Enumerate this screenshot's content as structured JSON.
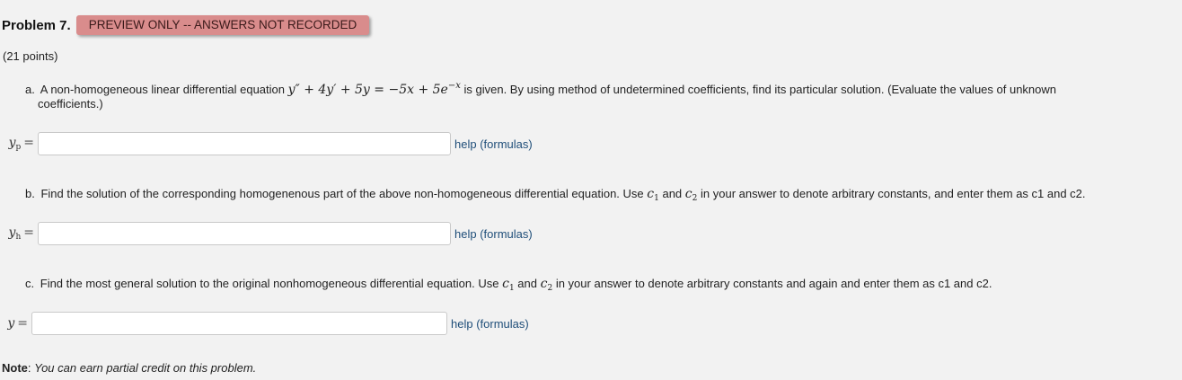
{
  "problem": {
    "title": "Problem 7.",
    "badge": "PREVIEW ONLY -- ANSWERS NOT RECORDED",
    "points": "(21 points)"
  },
  "part_a": {
    "marker": "a.",
    "text_before": "A non-homogeneous linear differential equation",
    "equation": "y″ + 4y′ + 5y = −5x + 5e",
    "equation_exp": "−x",
    "text_after": "is given. By using method of undetermined coefficients, find its particular solution. (Evaluate the values of unknown",
    "text_line2": "coefficients.)",
    "answer_label": "y",
    "answer_sub": "p",
    "answer_value": "",
    "help_label": "help (formulas)"
  },
  "part_b": {
    "marker": "b.",
    "text_before": "Find the solution of the corresponding homogenenous part of the above non-homogeneous differential equation. Use",
    "c1": "c",
    "c1_sub": "1",
    "and": "and",
    "c2": "c",
    "c2_sub": "2",
    "text_after": "in your answer to denote arbitrary constants, and enter them as c1 and c2.",
    "answer_label": "y",
    "answer_sub": "h",
    "answer_value": "",
    "help_label": "help (formulas)"
  },
  "part_c": {
    "marker": "c.",
    "text_before": "Find the most general solution to the original nonhomogeneous differential equation. Use",
    "c1": "c",
    "c1_sub": "1",
    "and": "and",
    "c2": "c",
    "c2_sub": "2",
    "text_after": "in your answer to denote arbitrary constants and again and enter them as c1 and c2.",
    "answer_label": "y",
    "answer_value": "",
    "help_label": "help (formulas)"
  },
  "note": {
    "label": "Note",
    "text": "You can earn partial credit on this problem."
  },
  "colors": {
    "badge_bg": "#d98c8c",
    "link": "#1f4e79",
    "page_bg": "#f2f2f2"
  }
}
